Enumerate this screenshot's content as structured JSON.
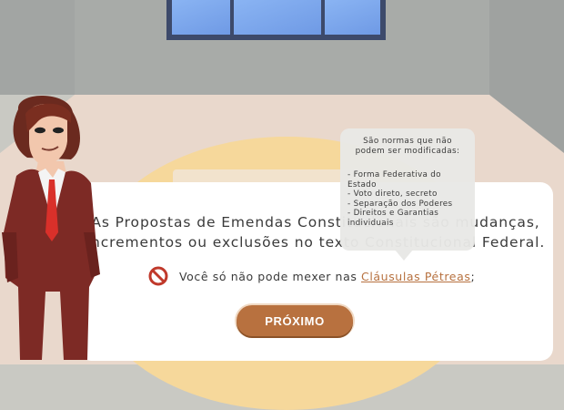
{
  "dialog": {
    "main_text_line1": "As Propostas de Emendas Constitucionais são mudanças,",
    "main_text_line2": "incrementos ou exclusões no texto Constitucional Federal.",
    "note_prefix": "Você só não pode mexer nas ",
    "note_link": "Cláusulas Pétreas",
    "note_suffix": ";",
    "next_button": "PRÓXIMO"
  },
  "tooltip": {
    "heading_line1": "São normas que não",
    "heading_line2": "podem ser modificadas:",
    "items": [
      "- Forma Federativa do",
      "Estado",
      "- Voto direto, secreto",
      "- Separação dos Poderes",
      "- Direitos e Garantias",
      "individuais"
    ]
  },
  "icons": {
    "prohibited": "prohibited-icon"
  },
  "colors": {
    "accent": "#b8713f",
    "prohibited": "#c0392b",
    "floor": "#e9d8cc",
    "rug": "#f6d89b",
    "window": "#7ea6ee"
  }
}
